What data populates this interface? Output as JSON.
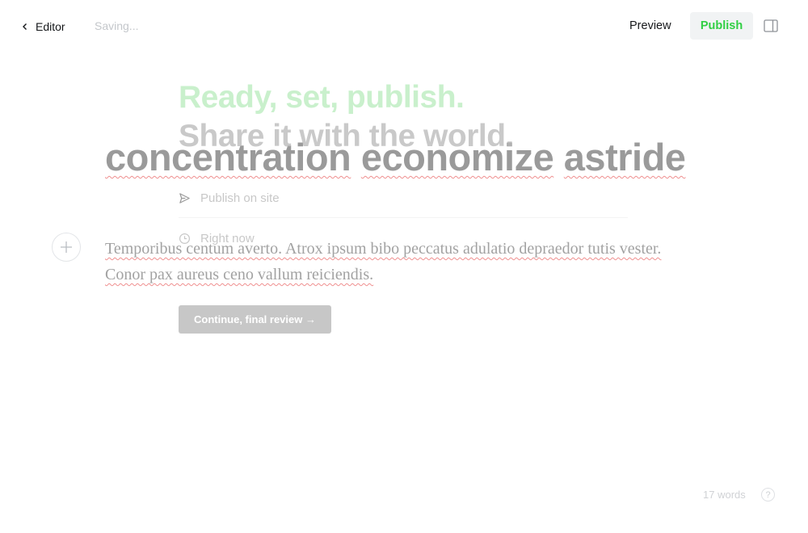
{
  "topbar": {
    "back_label": "Editor",
    "status": "Saving...",
    "preview_label": "Preview",
    "publish_label": "Publish"
  },
  "publish_flow": {
    "heading_line1": "Ready, set, publish.",
    "heading_line2": "Share it with the world.",
    "publish_option": "Publish on site",
    "time_option": "Right now",
    "continue_label": "Continue, final review →"
  },
  "post": {
    "title_words": [
      "concentration",
      "economize",
      "astride"
    ],
    "body": "Temporibus centum averto. Atrox ipsum bibo peccatus adulatio depraedor tutis vester. Conor pax aureus ceno vallum reiciendis."
  },
  "footer": {
    "word_count": "17 words",
    "help": "?"
  },
  "colors": {
    "accent_green": "#30cf43",
    "spellcheck_red": "#ef8f8f"
  },
  "icons": [
    "chevron-left-icon",
    "sidebar-panel-icon",
    "plus-icon",
    "send-icon",
    "clock-icon",
    "help-icon"
  ]
}
